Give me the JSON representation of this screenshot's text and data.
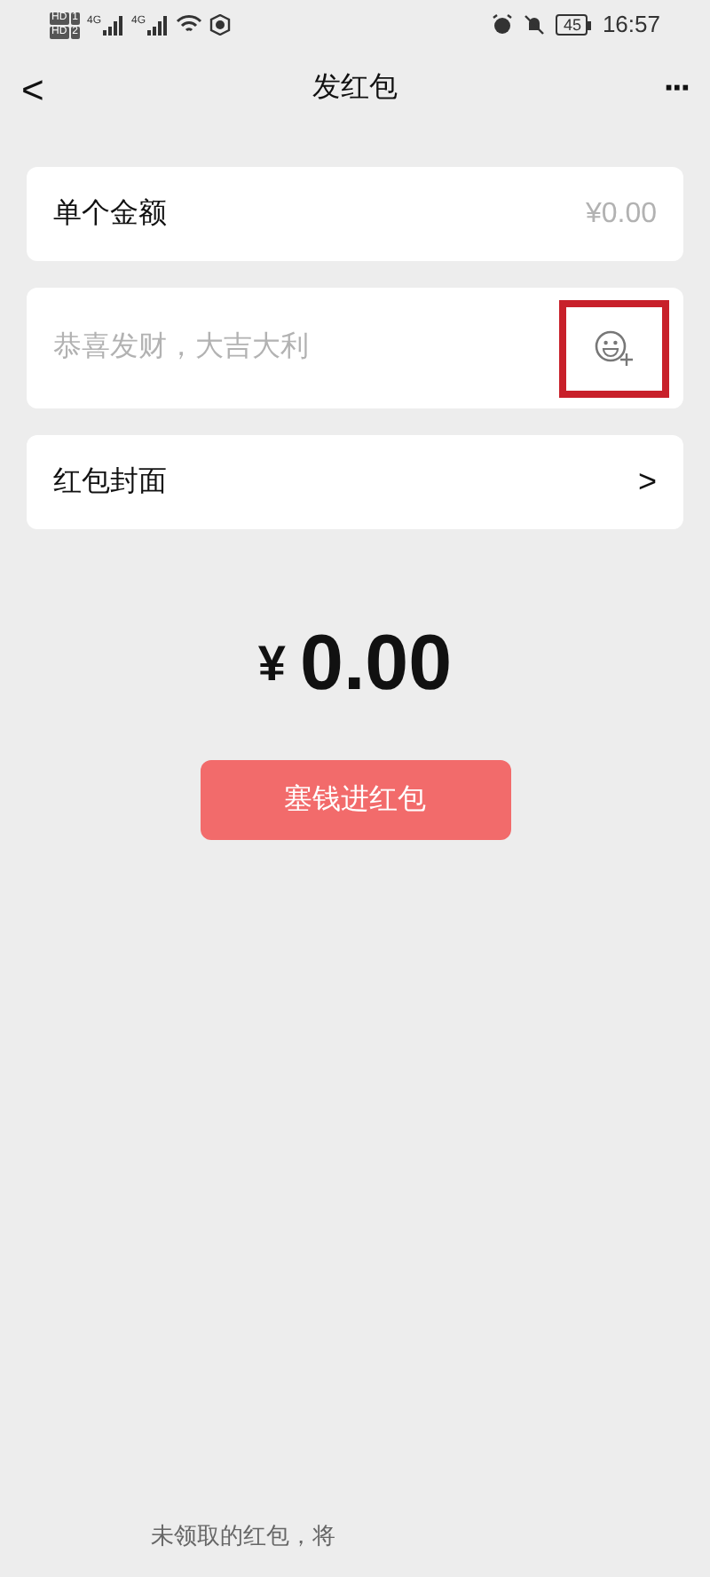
{
  "status_bar": {
    "sims": [
      {
        "badge": "HD",
        "slot": "1"
      },
      {
        "badge": "HD",
        "slot": "2"
      }
    ],
    "networks": [
      "4G",
      "4G"
    ],
    "battery": "45",
    "time": "16:57"
  },
  "nav": {
    "back": "<",
    "title": "发红包",
    "more": "···"
  },
  "amount_row": {
    "label": "单个金额",
    "placeholder": "¥0.00"
  },
  "message_row": {
    "placeholder": "恭喜发财，大吉大利"
  },
  "cover_row": {
    "label": "红包封面",
    "chevron": ">"
  },
  "total": {
    "currency": "¥",
    "value": "0.00"
  },
  "submit_button": {
    "label": "塞钱进红包",
    "disabled": true
  },
  "footer_note": "未领取的红包，将"
}
